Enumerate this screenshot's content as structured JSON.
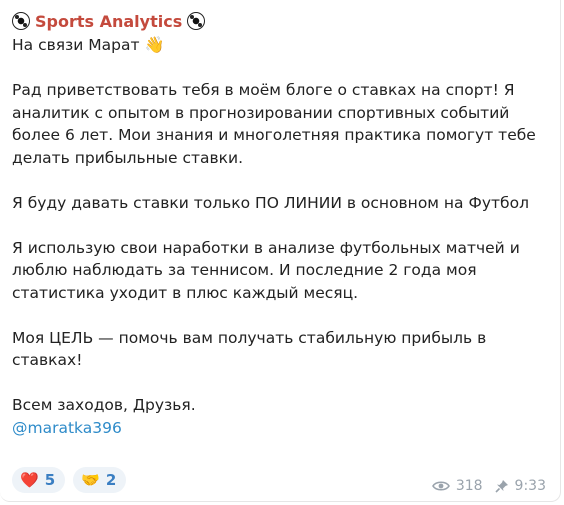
{
  "post": {
    "channel_name": "Sports Analytics",
    "greeting": "На связи Марат",
    "greeting_emoji": "👋",
    "paragraphs": [
      [
        "Рад приветствовать тебя в моём блоге о ставках на спорт! Я",
        "аналитик с опытом в прогнозировании спортивных событий",
        "более 6 лет. Мои знания и многолетняя практика помогут тебе",
        "делать прибыльные ставки."
      ],
      [
        "Я буду давать ставки  только ПО ЛИНИИ  в основном на Футбол"
      ],
      [
        "Я использую свои наработки в анализе футбольных  матчей  и",
        "люблю наблюдать за теннисом. И последние 2 года моя",
        "статистика уходит в плюс каждый месяц."
      ],
      [
        "Моя ЦЕЛЬ — помочь вам получать стабильную прибыль в",
        "ставках!"
      ],
      [
        "Всем заходов, Друзья."
      ]
    ],
    "handle": "@maratka396"
  },
  "reactions": [
    {
      "emoji": "❤️",
      "icon": "heart-icon",
      "count": "5"
    },
    {
      "emoji": "🤝",
      "icon": "handshake-icon",
      "count": "2"
    }
  ],
  "meta": {
    "views": "318",
    "time": "9:33"
  }
}
